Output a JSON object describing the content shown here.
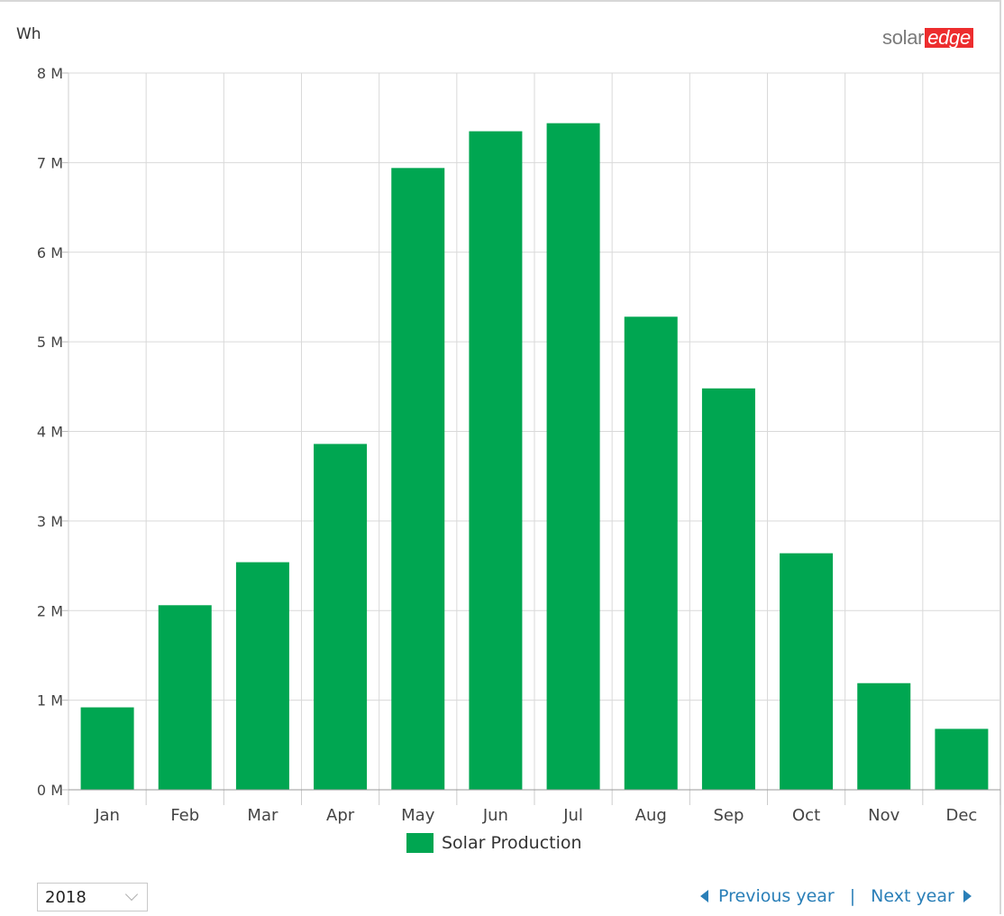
{
  "header": {
    "unit_label": "Wh",
    "logo_part1": "solar",
    "logo_part2": "edge"
  },
  "colors": {
    "bar": "#00a651",
    "grid": "#d9d9d9",
    "axis_text": "#444444",
    "link": "#2a7fb8",
    "logo_red": "#ed2d2e"
  },
  "chart_data": {
    "type": "bar",
    "categories": [
      "Jan",
      "Feb",
      "Mar",
      "Apr",
      "May",
      "Jun",
      "Jul",
      "Aug",
      "Sep",
      "Oct",
      "Nov",
      "Dec"
    ],
    "series": [
      {
        "name": "Solar Production",
        "values": [
          920000,
          2060000,
          2540000,
          3860000,
          6940000,
          7350000,
          7440000,
          5280000,
          4480000,
          2640000,
          1190000,
          680000
        ]
      }
    ],
    "ylabel": "Wh",
    "ylim": [
      0,
      8000000
    ],
    "yticks": [
      "0 M",
      "1 M",
      "2 M",
      "3 M",
      "4 M",
      "5 M",
      "6 M",
      "7 M",
      "8 M"
    ],
    "grid": true,
    "legend_position": "bottom-center"
  },
  "legend": {
    "label": "Solar Production"
  },
  "controls": {
    "year_value": "2018",
    "previous_label": "Previous year",
    "separator": "|",
    "next_label": "Next year"
  }
}
